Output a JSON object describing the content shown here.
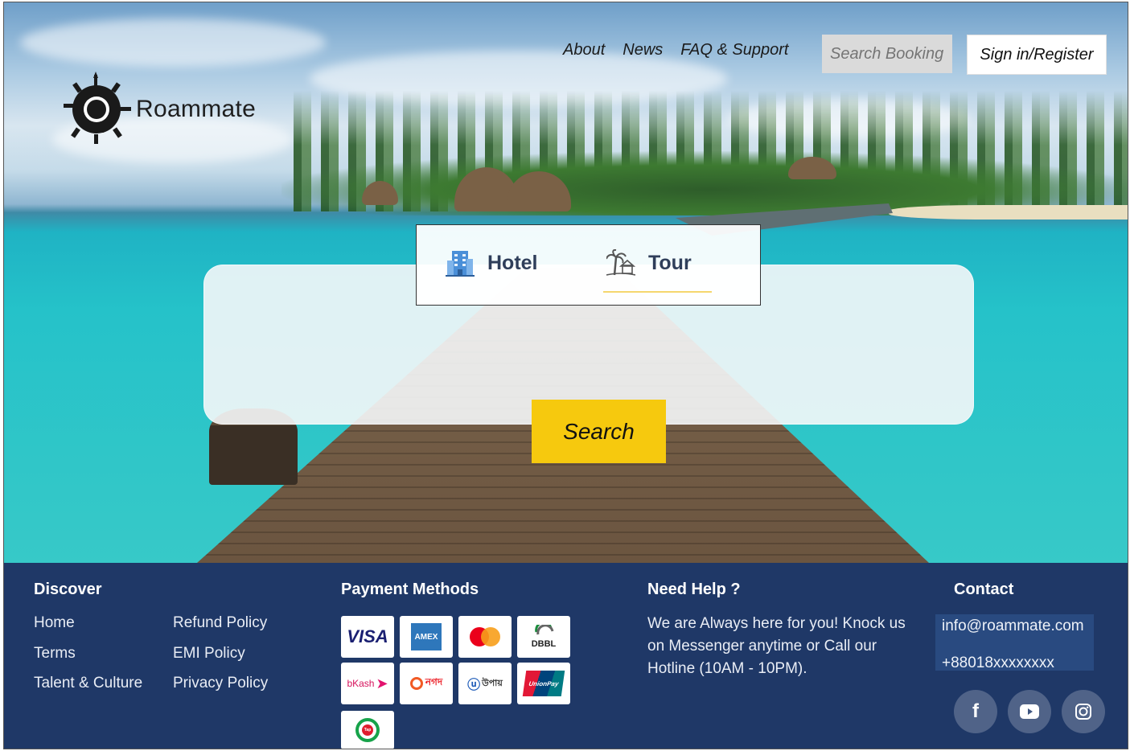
{
  "nav": {
    "links": [
      "About",
      "News",
      "FAQ & Support"
    ],
    "search_placeholder": "Search Booking",
    "signin_label": "Sign in/Register"
  },
  "brand": {
    "name": "Roammate"
  },
  "booking": {
    "tabs": [
      {
        "label": "Hotel",
        "icon": "hotel-building-icon"
      },
      {
        "label": "Tour",
        "icon": "palm-tree-icon",
        "active": true
      }
    ],
    "search_label": "Search"
  },
  "footer": {
    "discover": {
      "heading": "Discover",
      "col1": [
        "Home",
        "Terms",
        "Talent & Culture"
      ],
      "col2": [
        "Refund Policy",
        "EMI Policy",
        "Privacy Policy"
      ]
    },
    "payment": {
      "heading": "Payment Methods",
      "methods": [
        "VISA",
        "AMEX",
        "Mastercard",
        "DBBL",
        "bKash",
        "নগদ",
        "উপায়",
        "UnionPay",
        "Tap"
      ]
    },
    "help": {
      "heading": "Need Help ?",
      "text": "We are Always here for you! Knock us on Messenger anytime or Call our Hotline (10AM - 10PM)."
    },
    "contact": {
      "heading": "Contact",
      "email": "info@roammate.com",
      "phone": "+88018xxxxxxxx",
      "social": [
        "facebook-icon",
        "youtube-icon",
        "instagram-icon"
      ]
    }
  },
  "colors": {
    "footer_bg": "#1f3867",
    "search_button": "#f6c90e",
    "tab_underline": "#f5d76e"
  }
}
